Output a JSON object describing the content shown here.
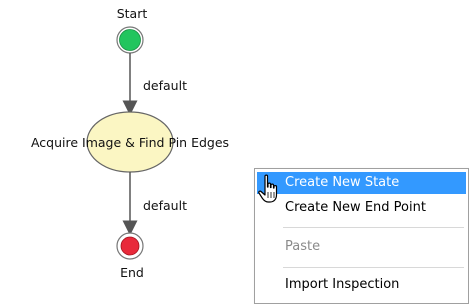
{
  "diagram": {
    "start_label": "Start",
    "end_label": "End",
    "state_label": "Acquire Image & Find Pin Edges",
    "edge1_label": "default",
    "edge2_label": "default",
    "colors": {
      "start_fill": "#22c55e",
      "end_fill": "#e8293a",
      "state_fill": "#fbf6c3",
      "edge": "#555555"
    }
  },
  "context_menu": {
    "items": [
      {
        "label": "Create New State",
        "state": "highlighted"
      },
      {
        "label": "Create New End Point",
        "state": "normal"
      },
      {
        "label": "Paste",
        "state": "disabled"
      },
      {
        "label": "Import Inspection",
        "state": "normal"
      }
    ],
    "highlight_color": "#3399ff"
  },
  "cursor": {
    "icon": "hand-pointer-icon"
  }
}
